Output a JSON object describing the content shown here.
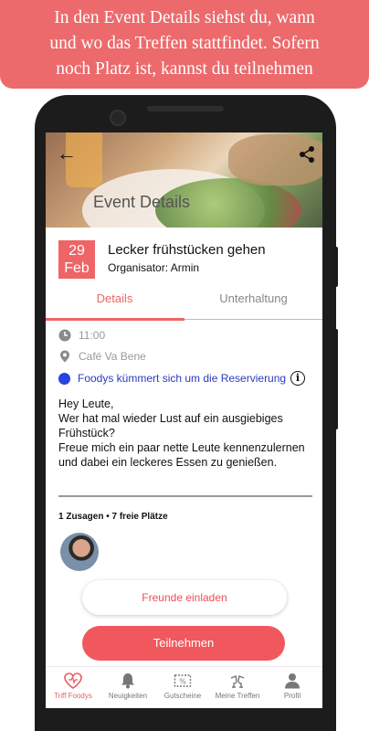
{
  "banner": {
    "line1": "In den Event Details siehst du, wann",
    "line2": "und wo das Treffen stattfindet. Sofern",
    "line3": "noch Platz ist, kannst du teilnehmen"
  },
  "header": {
    "title": "Event Details",
    "back_icon": "arrow-left-icon",
    "share_icon": "share-icon"
  },
  "event": {
    "day": "29",
    "month": "Feb",
    "title": "Lecker frühstücken gehen",
    "organizer": "Organisator: Armin"
  },
  "tabs": [
    {
      "label": "Details",
      "active": true
    },
    {
      "label": "Unterhaltung",
      "active": false
    }
  ],
  "info": {
    "time": "11:00",
    "place": "Café Va Bene",
    "reservation": "Foodys kümmert sich um die Reservierung"
  },
  "description": "Hey Leute,\nWer hat mal wieder Lust auf ein ausgiebiges Frühstück?\nFreue mich ein paar nette Leute kennenzulernen und dabei ein leckeres Essen zu genießen.",
  "attendance": "1 Zusagen • 7 freie Plätze",
  "buttons": {
    "invite": "Freunde einladen",
    "join": "Teilnehmen"
  },
  "nav": [
    {
      "label": "Triff Foodys",
      "icon": "heart-icon",
      "active": true
    },
    {
      "label": "Neuigkeiten",
      "icon": "bell-icon",
      "active": false
    },
    {
      "label": "Gutscheine",
      "icon": "voucher-icon",
      "active": false
    },
    {
      "label": "Meine Treffen",
      "icon": "cheers-icon",
      "active": false
    },
    {
      "label": "Profil",
      "icon": "person-icon",
      "active": false
    }
  ],
  "colors": {
    "accent": "#ee6467",
    "banner": "#ec6a6c",
    "reservation": "#2a3bc0"
  }
}
